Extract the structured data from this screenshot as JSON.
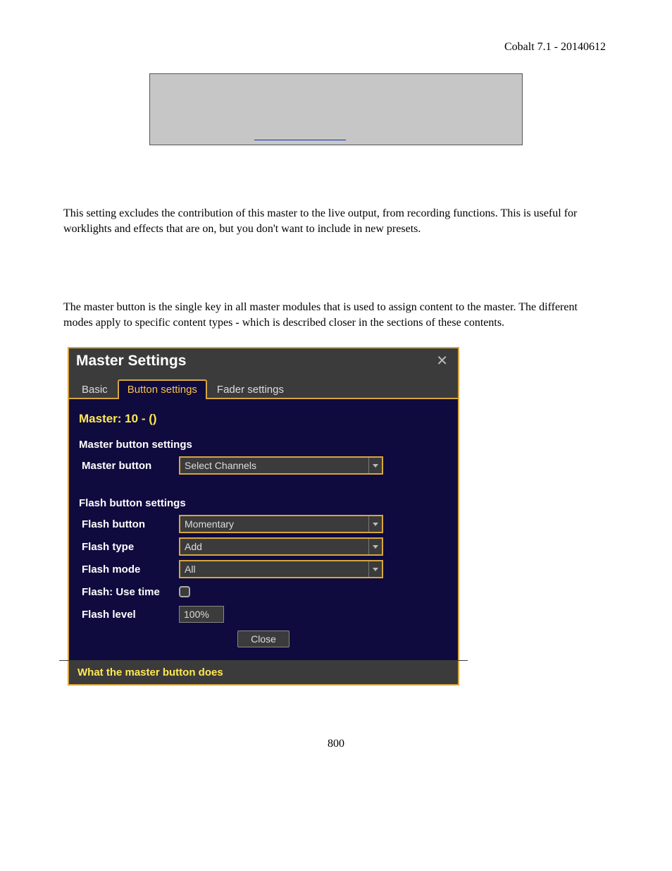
{
  "header": {
    "version": "Cobalt 7.1 - 20140612"
  },
  "paragraph1": "This setting excludes the contribution of this master to the live output, from recording functions. This is useful for worklights and effects that are on, but you don't want to include in new presets.",
  "paragraph2": "The master button is the single key in all master modules that is used to assign content to the master. The different modes apply to specific content types - which is described closer in the sections of these contents.",
  "dialog": {
    "title": "Master Settings",
    "tabs": {
      "basic": "Basic",
      "button": "Button settings",
      "fader": "Fader settings"
    },
    "master_header": "Master: 10 - ()",
    "section_master": "Master button settings",
    "labels": {
      "master_button": "Master button",
      "flash_button": "Flash button",
      "flash_type": "Flash type",
      "flash_mode": "Flash mode",
      "flash_use_time": "Flash: Use time",
      "flash_level": "Flash level"
    },
    "values": {
      "master_button": "Select Channels",
      "flash_button": "Momentary",
      "flash_type": "Add",
      "flash_mode": "All",
      "flash_level": "100%"
    },
    "section_flash": "Flash button settings",
    "close_btn": "Close",
    "bottom_text": "What the master button does"
  },
  "page_number": "800"
}
